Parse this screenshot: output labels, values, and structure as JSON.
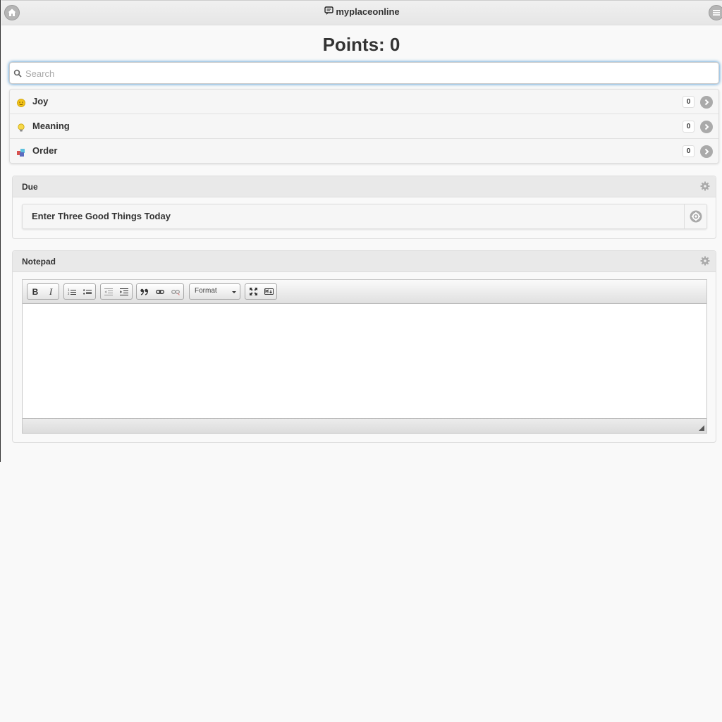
{
  "header": {
    "title": "myplaceonline",
    "home_icon": "home-icon",
    "menu_icon": "menu-icon",
    "logo_icon": "chat-logo-icon"
  },
  "points": {
    "label": "Points: 0"
  },
  "search": {
    "placeholder": "Search",
    "value": ""
  },
  "categories": [
    {
      "label": "Joy",
      "count": "0",
      "icon": "smiley-icon"
    },
    {
      "label": "Meaning",
      "count": "0",
      "icon": "lightbulb-icon"
    },
    {
      "label": "Order",
      "count": "0",
      "icon": "blocks-icon"
    }
  ],
  "due": {
    "title": "Due",
    "items": [
      {
        "label": "Enter Three Good Things Today"
      }
    ]
  },
  "notepad": {
    "title": "Notepad",
    "format_label": "Format",
    "toolbar": {
      "bold": "B",
      "italic": "I"
    },
    "content": ""
  },
  "colors": {
    "focus_glow": "#3388cc",
    "header_bg": "#e9e9e9",
    "page_bg": "#f9f9f9"
  }
}
